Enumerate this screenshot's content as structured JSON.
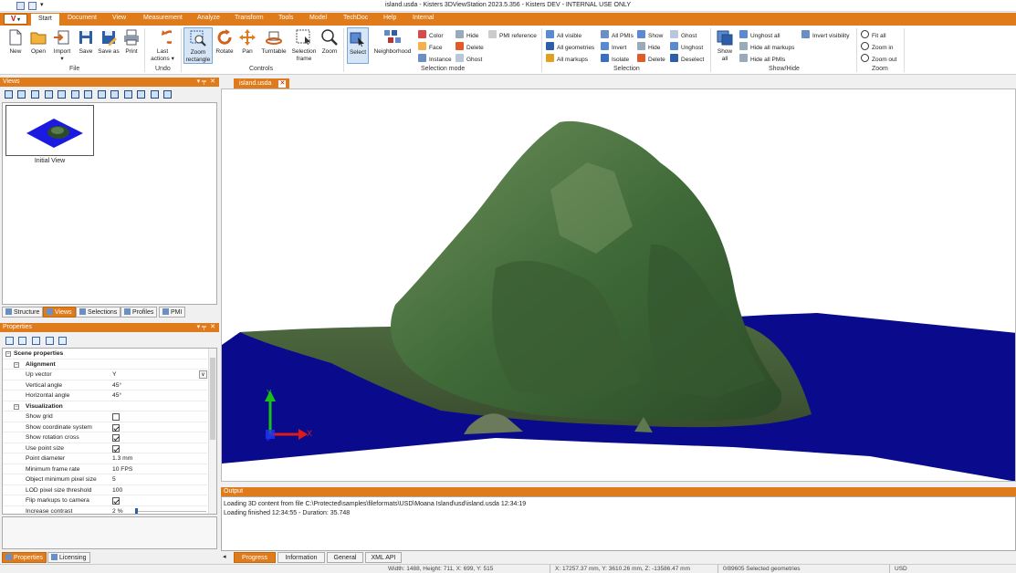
{
  "window": {
    "title": "island.usda - Kisters 3DViewStation 2023.5.356 - Kisters DEV - INTERNAL USE ONLY"
  },
  "menu": {
    "app_button": "V",
    "items": [
      "Start",
      "Document",
      "View",
      "Measurement",
      "Analyze",
      "Transform",
      "Tools",
      "Model",
      "TechDoc",
      "Help",
      "Internal"
    ]
  },
  "ribbon": {
    "file": {
      "new": "New",
      "open": "Open",
      "import": "Import",
      "save": "Save",
      "save_as": "Save as",
      "print": "Print",
      "group": "File"
    },
    "undo": {
      "last_actions": "Last actions",
      "group": "Undo"
    },
    "controls": {
      "zoom_rectangle": "Zoom rectangle",
      "rotate": "Rotate",
      "pan": "Pan",
      "turntable": "Turntable",
      "selection_frame": "Selection frame",
      "zoom": "Zoom",
      "group": "Controls"
    },
    "selection_mode": {
      "select": "Select",
      "neighborhood": "Neighborhood",
      "color": "Color",
      "face": "Face",
      "instance": "Instance",
      "hide": "Hide",
      "delete": "Delete",
      "ghost": "Ghost",
      "pmi_reference": "PMI reference",
      "group": "Selection mode"
    },
    "selection": {
      "all_visible": "All visible",
      "all_geometries": "All geometries",
      "all_markups": "All markups",
      "all_pmis": "All PMIs",
      "invert": "Invert",
      "isolate": "Isolate",
      "show": "Show",
      "hide": "Hide",
      "delete": "Delete",
      "ghost": "Ghost",
      "unghost": "Unghost",
      "deselect": "Deselect",
      "group": "Selection"
    },
    "show_hide": {
      "show_all": "Show all",
      "unghost_all": "Unghost all",
      "hide_all_markups": "Hide all markups",
      "hide_all_pmis": "Hide all PMIs",
      "invert_visibility": "Invert visibility",
      "group": "Show/Hide"
    },
    "zoom": {
      "fit_all": "Fit all",
      "zoom_in": "Zoom in",
      "zoom_out": "Zoom out",
      "group": "Zoom"
    }
  },
  "views_panel": {
    "title": "Views",
    "thumbnail_label": "Initial View",
    "tabs": [
      "Structure",
      "Views",
      "Selections",
      "Profiles",
      "PMI"
    ],
    "active_tab": "Views"
  },
  "properties_panel": {
    "title": "Properties",
    "section": "Scene properties",
    "alignment": {
      "title": "Alignment",
      "up_vector": {
        "label": "Up vector",
        "value": "Y"
      },
      "vertical_angle": {
        "label": "Vertical angle",
        "value": "45°"
      },
      "horizontal_angle": {
        "label": "Horizontal angle",
        "value": "45°"
      }
    },
    "visualization": {
      "title": "Visualization",
      "show_grid": {
        "label": "Show grid",
        "checked": false
      },
      "show_coordinate_system": {
        "label": "Show coordinate system",
        "checked": true
      },
      "show_rotation_cross": {
        "label": "Show rotation cross",
        "checked": true
      },
      "use_point_size": {
        "label": "Use point size",
        "checked": true
      },
      "point_diameter": {
        "label": "Point diameter",
        "value": "1.3 mm"
      },
      "minimum_frame_rate": {
        "label": "Minimum frame rate",
        "value": "10 FPS"
      },
      "object_min_pixel_size": {
        "label": "Object minimum pixel size",
        "value": "5"
      },
      "lod_pixel_size_threshold": {
        "label": "LOD pixel size threshold",
        "value": "100"
      },
      "flip_markups_to_camera": {
        "label": "Flip markups to camera",
        "checked": true
      },
      "increase_contrast": {
        "label": "Increase contrast",
        "value": "2 %"
      }
    },
    "bottom_tabs": [
      "Properties",
      "Licensing"
    ]
  },
  "document": {
    "tab": "island.usda",
    "axis_label": "X"
  },
  "output": {
    "title": "Output",
    "lines": [
      "Loading 3D content from file C:\\Protected\\samples\\fileformats\\USD\\Moana Island\\usd\\island.usda 12:34:19",
      "Loading finished 12:34:55 - Duration: 35.748"
    ],
    "tabs": [
      "Progress",
      "Information",
      "General",
      "XML API"
    ],
    "active_tab": "Progress"
  },
  "status": {
    "viewport": "Width: 1488, Height: 711, X: 699, Y: 515",
    "coordinates": "X: 17257.37 mm, Y: 3610.26 mm, Z: -13586.47 mm",
    "selection": "0/89605 Selected geometries",
    "format": "USD"
  },
  "colors": {
    "accent": "#e07b1c",
    "water": "#0a0a8c",
    "terrain": "#3e6a38"
  }
}
